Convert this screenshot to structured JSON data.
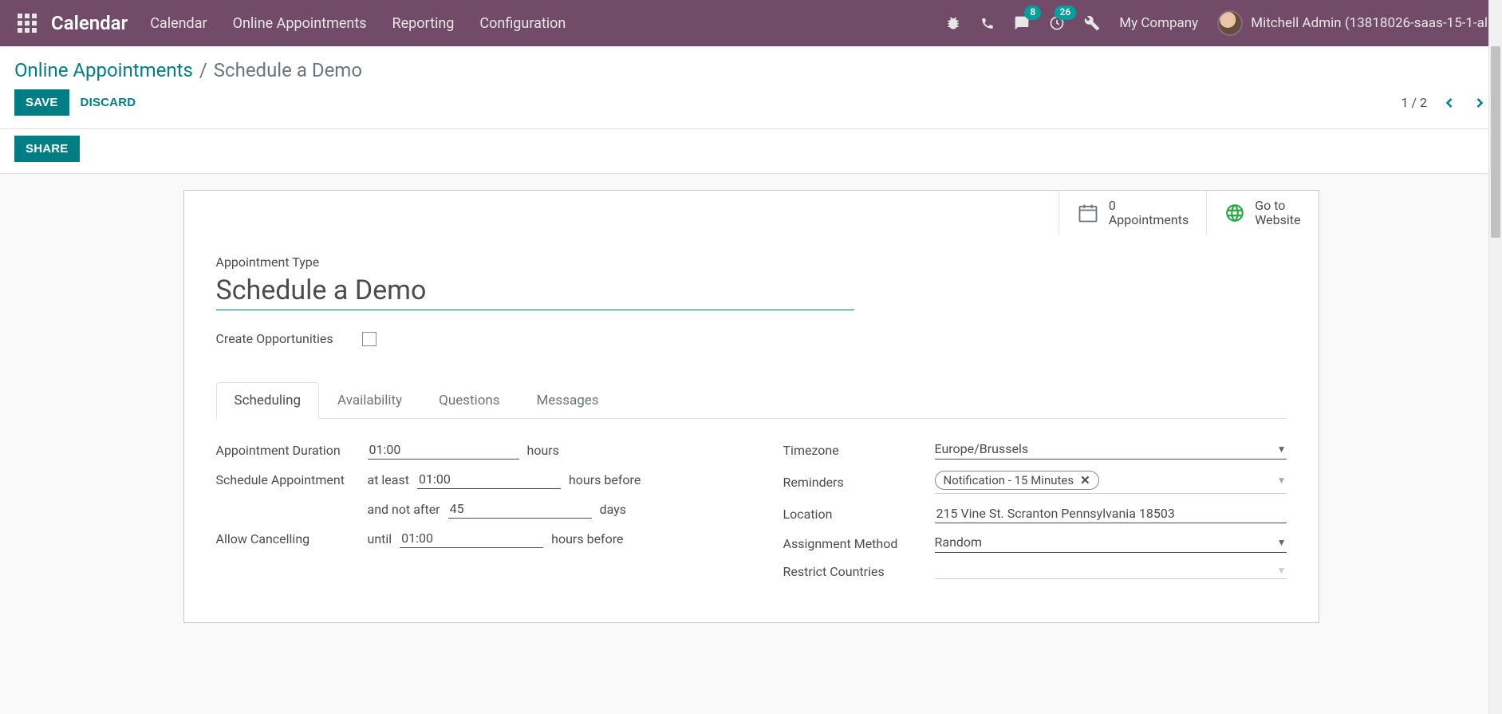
{
  "navbar": {
    "brand": "Calendar",
    "menu": [
      "Calendar",
      "Online Appointments",
      "Reporting",
      "Configuration"
    ],
    "badges": {
      "chat": "8",
      "clock": "26"
    },
    "company": "My Company",
    "user": "Mitchell Admin (13818026-saas-15-1-al"
  },
  "breadcrumb": {
    "parent": "Online Appointments",
    "sep": "/",
    "current": "Schedule a Demo"
  },
  "actions": {
    "save": "SAVE",
    "discard": "DISCARD",
    "share": "SHARE",
    "pager": "1 / 2"
  },
  "button_box": {
    "appointments": {
      "count": "0",
      "label": "Appointments"
    },
    "website": {
      "line1": "Go to",
      "line2": "Website"
    }
  },
  "form": {
    "title_label": "Appointment Type",
    "title_value": "Schedule a Demo",
    "create_opportunities_label": "Create Opportunities",
    "tabs": [
      "Scheduling",
      "Availability",
      "Questions",
      "Messages"
    ],
    "left": {
      "duration_label": "Appointment Duration",
      "duration_value": "01:00",
      "duration_suffix": "hours",
      "schedule_label": "Schedule Appointment",
      "schedule_prefix1": "at least",
      "schedule_val1": "01:00",
      "schedule_suffix1": "hours before",
      "schedule_prefix2": "and not after",
      "schedule_val2": "45",
      "schedule_suffix2": "days",
      "cancel_label": "Allow Cancelling",
      "cancel_prefix": "until",
      "cancel_value": "01:00",
      "cancel_suffix": "hours before"
    },
    "right": {
      "timezone_label": "Timezone",
      "timezone_value": "Europe/Brussels",
      "reminders_label": "Reminders",
      "reminders_tag": "Notification - 15 Minutes",
      "location_label": "Location",
      "location_value": "215 Vine St. Scranton Pennsylvania 18503",
      "assign_label": "Assignment Method",
      "assign_value": "Random",
      "restrict_label": "Restrict Countries"
    }
  }
}
